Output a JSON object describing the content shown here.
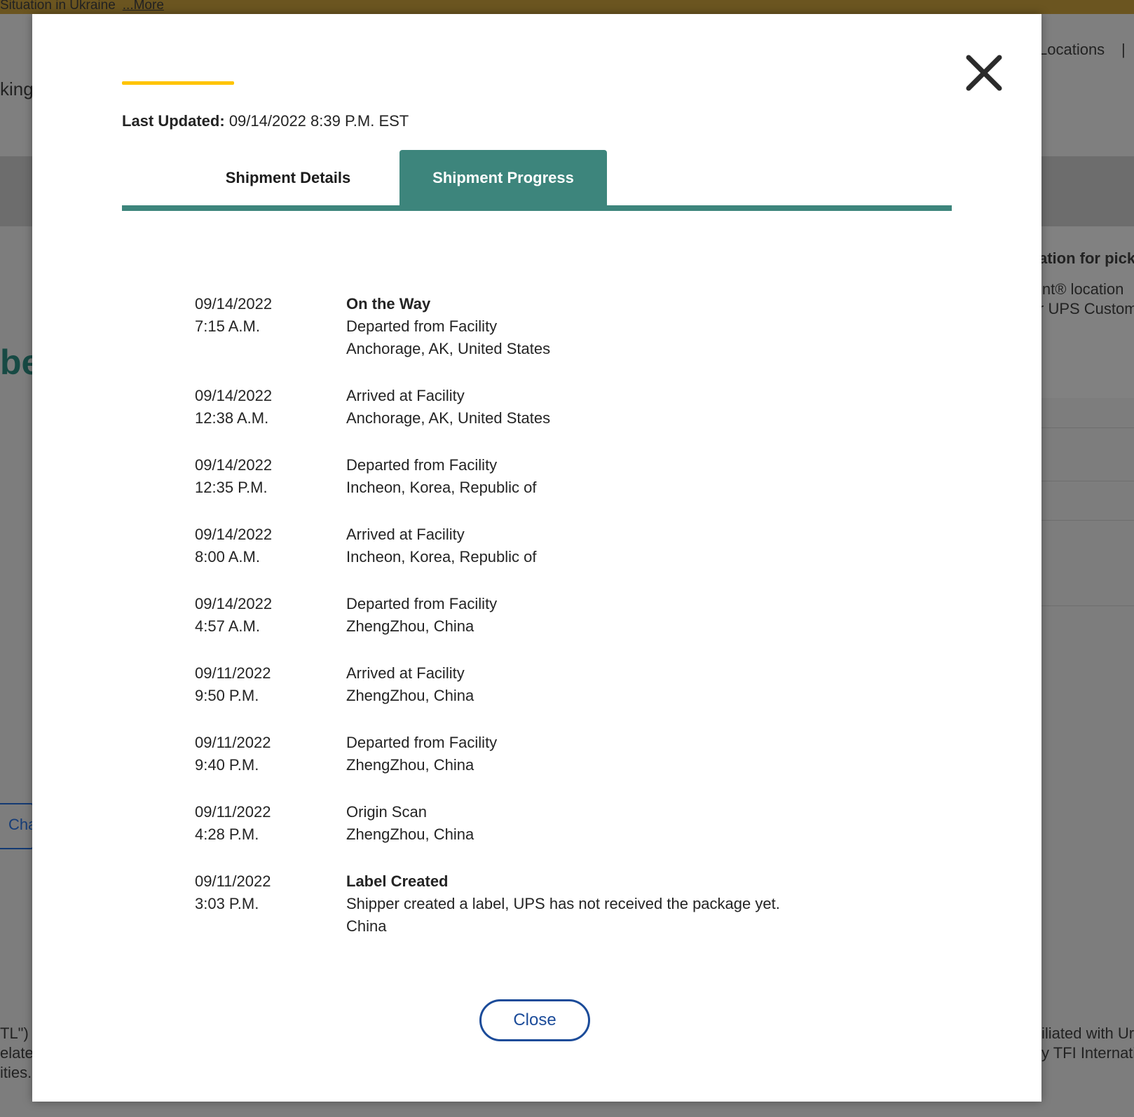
{
  "background": {
    "alert_text": "Situation in Ukraine",
    "alert_more": "...More",
    "nav_locations": "Locations",
    "nav_divider": "|",
    "header_fragment": "king",
    "big_fragment": "be",
    "right_heading": "ation for picku",
    "right_line1": "int® location",
    "right_line2": "r UPS Custom",
    "left_button": "Cha",
    "footer_left1": "TL\") t",
    "footer_left2": "elate",
    "footer_left3": "ities.",
    "footer_right1": "iliated with Ur",
    "footer_right2": "y TFI Internati"
  },
  "modal": {
    "last_updated_label": "Last Updated:",
    "last_updated_value": "09/14/2022 8:39 P.M. EST",
    "tabs": [
      {
        "label": "Shipment Details",
        "active": false
      },
      {
        "label": "Shipment Progress",
        "active": true
      }
    ],
    "events": [
      {
        "date": "09/14/2022",
        "time": "7:15 A.M.",
        "status": "On the Way",
        "lines": [
          "Departed from Facility",
          "Anchorage, AK, United States"
        ]
      },
      {
        "date": "09/14/2022",
        "time": "12:38 A.M.",
        "status": "",
        "lines": [
          "Arrived at Facility",
          "Anchorage, AK, United States"
        ]
      },
      {
        "date": "09/14/2022",
        "time": "12:35 P.M.",
        "status": "",
        "lines": [
          "Departed from Facility",
          "Incheon, Korea, Republic of"
        ]
      },
      {
        "date": "09/14/2022",
        "time": "8:00 A.M.",
        "status": "",
        "lines": [
          "Arrived at Facility",
          "Incheon, Korea, Republic of"
        ]
      },
      {
        "date": "09/14/2022",
        "time": "4:57 A.M.",
        "status": "",
        "lines": [
          "Departed from Facility",
          "ZhengZhou, China"
        ]
      },
      {
        "date": "09/11/2022",
        "time": "9:50 P.M.",
        "status": "",
        "lines": [
          "Arrived at Facility",
          "ZhengZhou, China"
        ]
      },
      {
        "date": "09/11/2022",
        "time": "9:40 P.M.",
        "status": "",
        "lines": [
          "Departed from Facility",
          "ZhengZhou, China"
        ]
      },
      {
        "date": "09/11/2022",
        "time": "4:28 P.M.",
        "status": "",
        "lines": [
          "Origin Scan",
          "ZhengZhou, China"
        ]
      },
      {
        "date": "09/11/2022",
        "time": "3:03 P.M.",
        "status": "Label Created",
        "lines": [
          "Shipper created a label, UPS has not received the package yet.",
          "China"
        ]
      }
    ],
    "close_label": "Close",
    "close_icon": "close-x-icon"
  },
  "colors": {
    "accent_yellow": "#ffc400",
    "tab_teal": "#3d857c",
    "button_blue": "#1b4b99"
  }
}
